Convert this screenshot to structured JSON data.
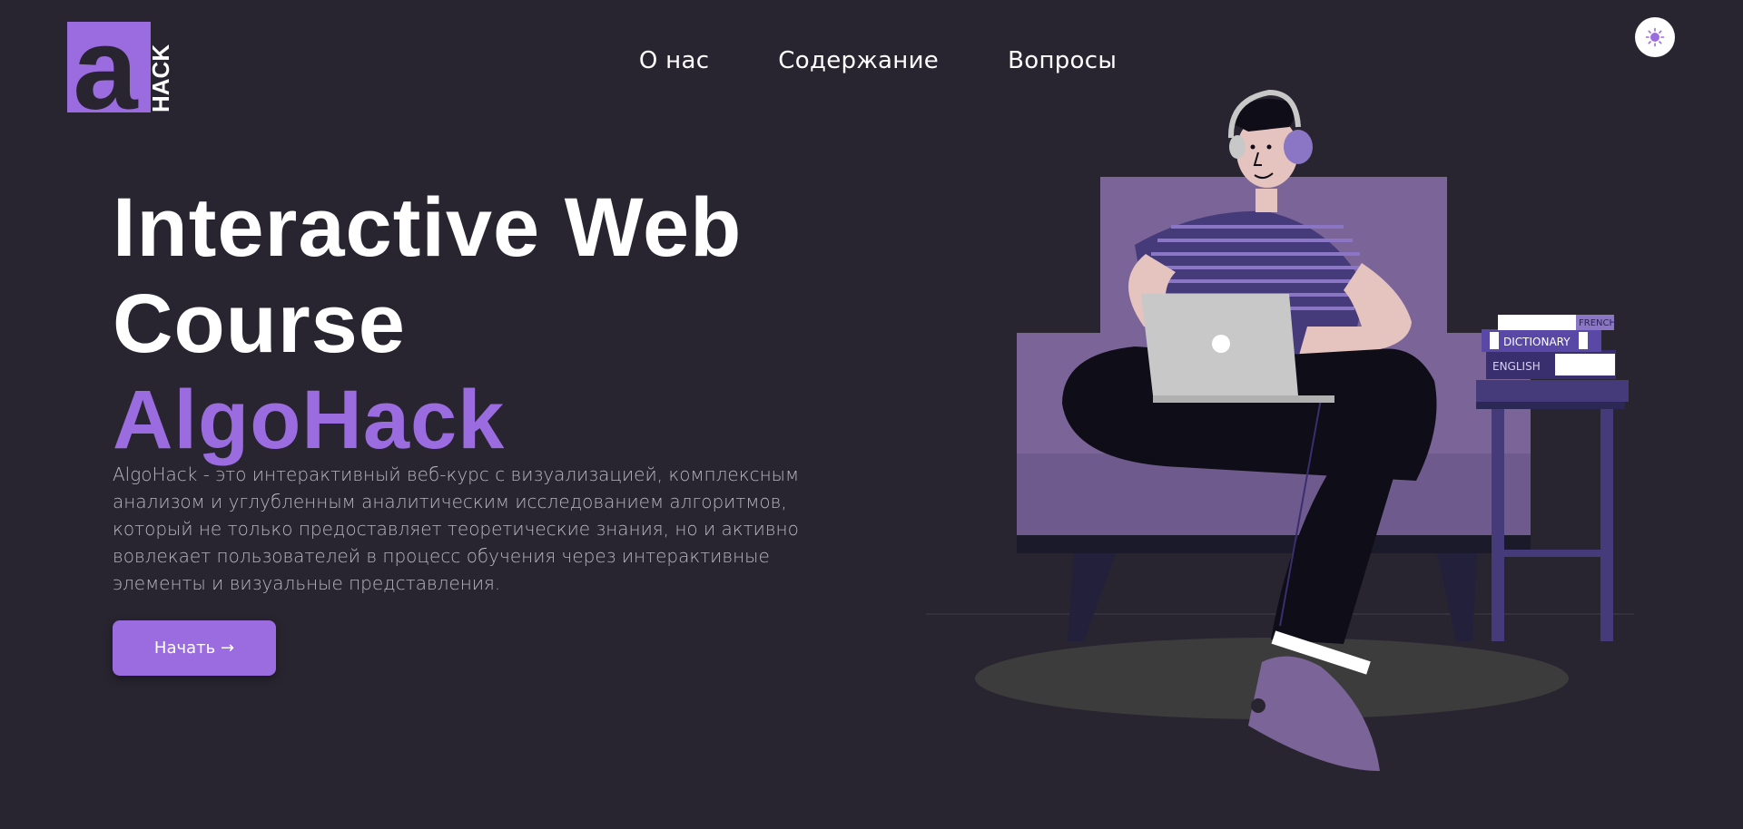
{
  "logo": {
    "letter": "a",
    "word": "HACK"
  },
  "nav": {
    "items": [
      {
        "label": "О нас"
      },
      {
        "label": "Содержание"
      },
      {
        "label": "Вопросы"
      }
    ]
  },
  "theme_toggle": {
    "icon": "sun-icon"
  },
  "hero": {
    "title_line1": "Interactive Web",
    "title_line2": "Course",
    "title_accent": "AlgoHack",
    "description": "AlgoHack - это интерактивный веб-курс с визуализацией, комплексным анализом и углубленным аналитическим исследованием алгоритмов, который не только предоставляет теоретические знания, но и активно вовлекает пользователей в процесс обучения через интерактивные элементы и визуальные представления.",
    "cta_label": "Начать →"
  },
  "illustration": {
    "books": [
      "FRENCH",
      "DICTIONARY",
      "ENGLISH"
    ]
  },
  "colors": {
    "background": "#282530",
    "accent": "#9b6be0",
    "text": "#ffffff",
    "muted_text": "#b8b4c2"
  }
}
